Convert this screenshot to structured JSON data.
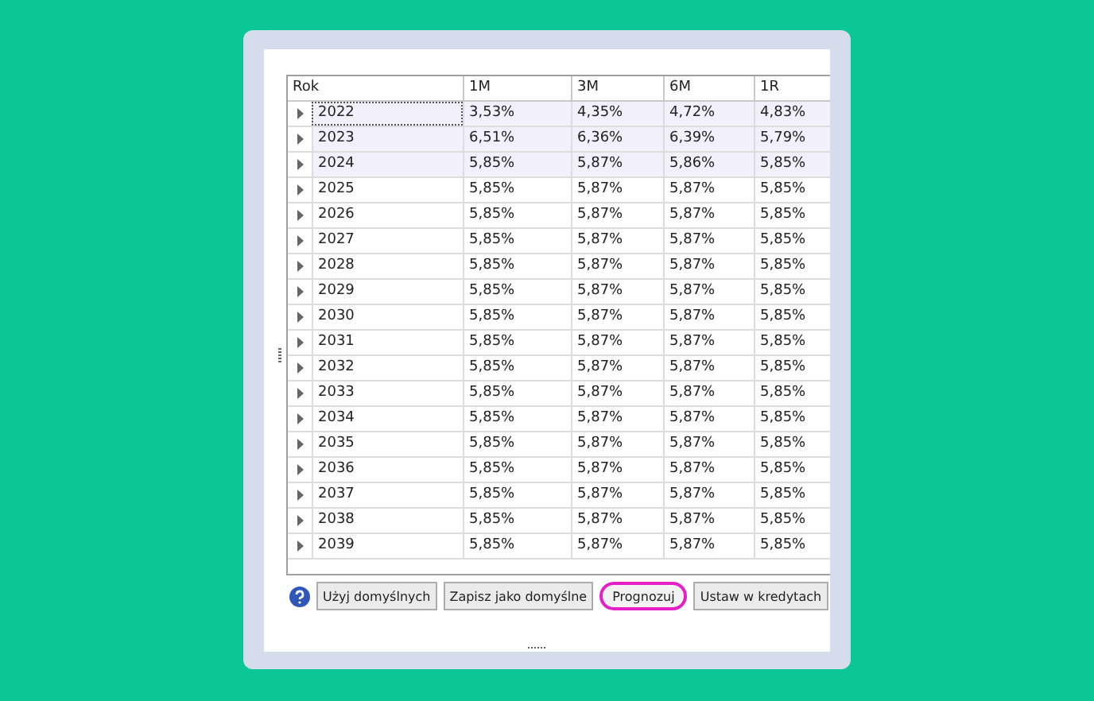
{
  "table": {
    "columns": [
      "Rok",
      "1M",
      "3M",
      "6M",
      "1R"
    ],
    "rows": [
      {
        "cells": [
          "2022",
          "3,53%",
          "4,35%",
          "4,72%",
          "4,83%"
        ],
        "highlighted": true,
        "focused": true
      },
      {
        "cells": [
          "2023",
          "6,51%",
          "6,36%",
          "6,39%",
          "5,79%"
        ],
        "highlighted": true,
        "focused": false
      },
      {
        "cells": [
          "2024",
          "5,85%",
          "5,87%",
          "5,86%",
          "5,85%"
        ],
        "highlighted": true,
        "focused": false
      },
      {
        "cells": [
          "2025",
          "5,85%",
          "5,87%",
          "5,87%",
          "5,85%"
        ],
        "highlighted": false,
        "focused": false
      },
      {
        "cells": [
          "2026",
          "5,85%",
          "5,87%",
          "5,87%",
          "5,85%"
        ],
        "highlighted": false,
        "focused": false
      },
      {
        "cells": [
          "2027",
          "5,85%",
          "5,87%",
          "5,87%",
          "5,85%"
        ],
        "highlighted": false,
        "focused": false
      },
      {
        "cells": [
          "2028",
          "5,85%",
          "5,87%",
          "5,87%",
          "5,85%"
        ],
        "highlighted": false,
        "focused": false
      },
      {
        "cells": [
          "2029",
          "5,85%",
          "5,87%",
          "5,87%",
          "5,85%"
        ],
        "highlighted": false,
        "focused": false
      },
      {
        "cells": [
          "2030",
          "5,85%",
          "5,87%",
          "5,87%",
          "5,85%"
        ],
        "highlighted": false,
        "focused": false
      },
      {
        "cells": [
          "2031",
          "5,85%",
          "5,87%",
          "5,87%",
          "5,85%"
        ],
        "highlighted": false,
        "focused": false
      },
      {
        "cells": [
          "2032",
          "5,85%",
          "5,87%",
          "5,87%",
          "5,85%"
        ],
        "highlighted": false,
        "focused": false
      },
      {
        "cells": [
          "2033",
          "5,85%",
          "5,87%",
          "5,87%",
          "5,85%"
        ],
        "highlighted": false,
        "focused": false
      },
      {
        "cells": [
          "2034",
          "5,85%",
          "5,87%",
          "5,87%",
          "5,85%"
        ],
        "highlighted": false,
        "focused": false
      },
      {
        "cells": [
          "2035",
          "5,85%",
          "5,87%",
          "5,87%",
          "5,85%"
        ],
        "highlighted": false,
        "focused": false
      },
      {
        "cells": [
          "2036",
          "5,85%",
          "5,87%",
          "5,87%",
          "5,85%"
        ],
        "highlighted": false,
        "focused": false
      },
      {
        "cells": [
          "2037",
          "5,85%",
          "5,87%",
          "5,87%",
          "5,85%"
        ],
        "highlighted": false,
        "focused": false
      },
      {
        "cells": [
          "2038",
          "5,85%",
          "5,87%",
          "5,87%",
          "5,85%"
        ],
        "highlighted": false,
        "focused": false
      },
      {
        "cells": [
          "2039",
          "5,85%",
          "5,87%",
          "5,87%",
          "5,85%"
        ],
        "highlighted": false,
        "focused": false
      }
    ]
  },
  "buttons": [
    {
      "label": "Użyj domyślnych",
      "circled": false
    },
    {
      "label": "Zapisz jako domyślne",
      "circled": false
    },
    {
      "label": "Prognozuj",
      "circled": true
    },
    {
      "label": "Ustaw w kredytach",
      "circled": false
    }
  ]
}
